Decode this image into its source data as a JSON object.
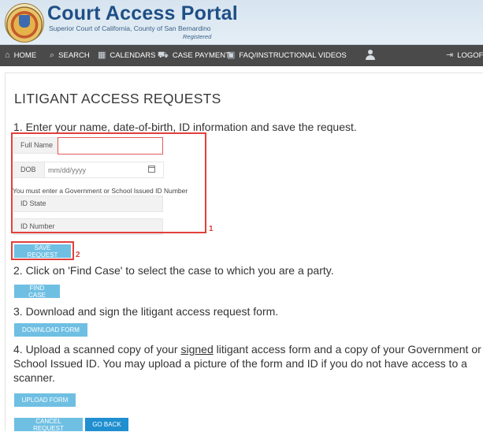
{
  "header": {
    "title": "Court Access Portal",
    "subtitle": "Superior Court of California, County of San Bernardino",
    "registered": "Registered"
  },
  "nav": {
    "items": [
      {
        "label": "HOME",
        "icon": "home-icon"
      },
      {
        "label": "SEARCH",
        "icon": "search-icon"
      },
      {
        "label": "CALENDARS",
        "icon": "calendar-icon"
      },
      {
        "label": "CASE PAYMENT",
        "icon": "car-icon"
      },
      {
        "label": "FAQ/INSTRUCTIONAL VIDEOS",
        "icon": "video-icon"
      },
      {
        "label": "LOGOF",
        "icon": "logout-icon"
      }
    ]
  },
  "page": {
    "title": "LITIGANT ACCESS REQUESTS",
    "step1": "1. Enter your name, date-of-birth, ID information and save the request.",
    "step2": "2. Click on 'Find Case' to select the case to which you are a party.",
    "step3": "3. Download and sign the litigant access request form.",
    "step4_part1": "4. Upload a scanned copy of your",
    "step4_underlined": "signed",
    "step4_part2": "litigant access form and a copy of your Government or School Issued ID. You may upload a picture of the form and ID if you do not have access to a scanner."
  },
  "form": {
    "full_name_label": "Full Name",
    "full_name_value": "",
    "dob_label": "DOB",
    "dob_placeholder": "mm/dd/yyyy",
    "id_note": "You must enter a Government or School Issued ID Number",
    "id_state_label": "ID State",
    "id_number_label": "ID Number"
  },
  "buttons": {
    "save_request": "SAVE REQUEST",
    "find_case": "FIND CASE",
    "download_form": "DOWNLOAD FORM",
    "upload_form": "UPLOAD FORM",
    "cancel_request": "CANCEL REQUEST",
    "go_back": "GO BACK"
  },
  "annotations": {
    "box1_number": "1",
    "box2_number": "2",
    "color": "#e0403a"
  }
}
